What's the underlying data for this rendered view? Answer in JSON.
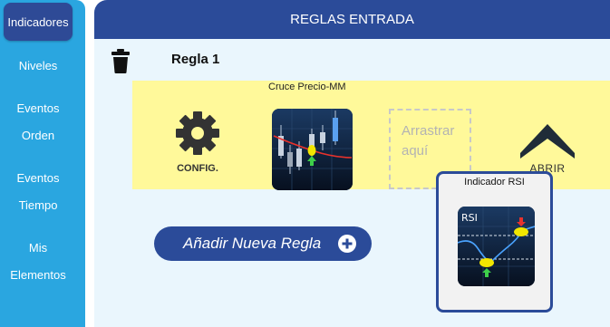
{
  "sidebar": {
    "active_item": "Indicadores",
    "items": [
      {
        "line1": "Niveles"
      },
      {
        "line1": "Eventos",
        "line2": "Orden"
      },
      {
        "line1": "Eventos",
        "line2": "Tiempo"
      },
      {
        "line1": "Mis",
        "line2": "Elementos"
      }
    ]
  },
  "panel": {
    "title": "REGLAS ENTRADA",
    "rule": {
      "title": "Regla 1",
      "config_label": "CONFIG.",
      "indicator_caption": "Cruce Precio-MM",
      "drop_zone_line1": "Arrastrar",
      "drop_zone_line2": "aquí",
      "open_label": "ABRIR"
    },
    "add_rule_label": "Añadir Nueva Regla"
  },
  "drag_card": {
    "caption": "Indicador RSI",
    "tile_label": "RSI"
  },
  "colors": {
    "sidebar": "#2aa6e0",
    "primary": "#2b4b99",
    "panel_bg": "#eaf6fd",
    "rule_row": "#fff99a",
    "tile_bg": "#0d1b30"
  }
}
